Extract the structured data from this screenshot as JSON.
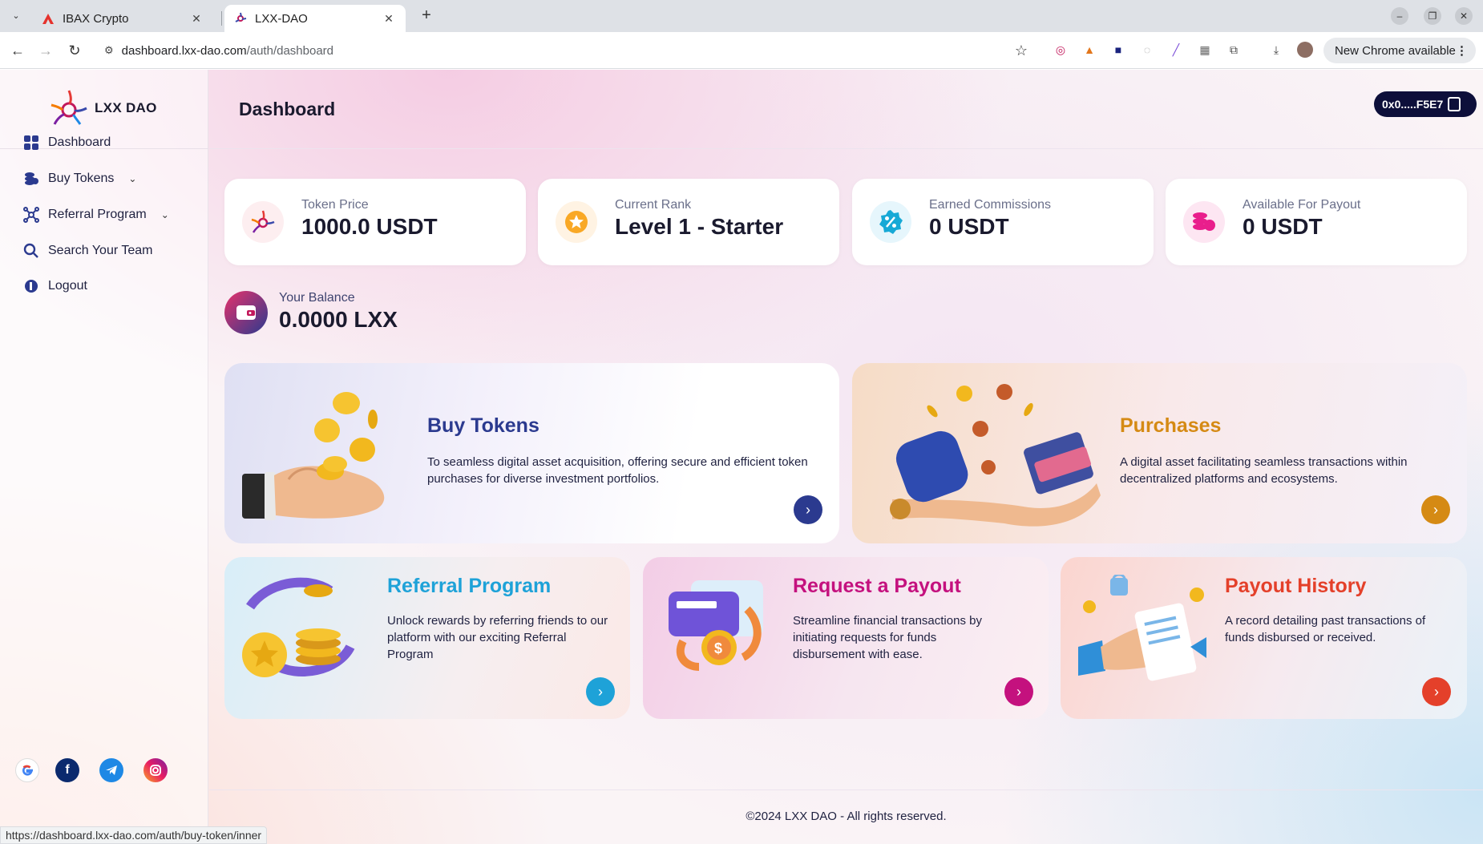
{
  "browser": {
    "tabs": [
      {
        "title": "IBAX Crypto",
        "active": false
      },
      {
        "title": "LXX-DAO",
        "active": true
      }
    ],
    "url_host": "dashboard.lxx-dao.com",
    "url_path": "/auth/dashboard",
    "update_button": "New Chrome available",
    "status_url": "https://dashboard.lxx-dao.com/auth/buy-token/inner"
  },
  "brand": {
    "name": "LXX DAO"
  },
  "sidebar": {
    "items": [
      {
        "label": "Dashboard",
        "icon": "grid-icon"
      },
      {
        "label": "Buy Tokens",
        "icon": "coins-icon",
        "has_submenu": true
      },
      {
        "label": "Referral Program",
        "icon": "network-icon",
        "has_submenu": true
      },
      {
        "label": "Search Your Team",
        "icon": "search-icon"
      },
      {
        "label": "Logout",
        "icon": "logout-icon"
      }
    ],
    "social": [
      "google-icon",
      "facebook-icon",
      "telegram-icon",
      "instagram-icon"
    ]
  },
  "header": {
    "title": "Dashboard",
    "wallet": "0x0.....F5E7"
  },
  "stats": [
    {
      "label": "Token Price",
      "value": "1000.0 USDT"
    },
    {
      "label": "Current Rank",
      "value": "Level 1 - Starter"
    },
    {
      "label": "Earned Commissions",
      "value": "0 USDT"
    },
    {
      "label": "Available For Payout",
      "value": "0 USDT"
    }
  ],
  "balance": {
    "label": "Your Balance",
    "value": "0.0000 LXX"
  },
  "features": [
    {
      "title": "Buy Tokens",
      "desc": "To seamless digital asset acquisition, offering secure and efficient token purchases for diverse investment portfolios.",
      "color": "#2b3a8f"
    },
    {
      "title": "Purchases",
      "desc": "A digital asset facilitating seamless transactions within decentralized platforms and ecosystems.",
      "color": "#d58a14"
    },
    {
      "title": "Referral Program",
      "desc": "Unlock rewards by referring friends to our platform with our exciting Referral Program",
      "color": "#1ea2d8"
    },
    {
      "title": "Request a Payout",
      "desc": "Streamline financial transactions by initiating requests for funds disbursement with ease.",
      "color": "#c4117e"
    },
    {
      "title": "Payout History",
      "desc": "A record detailing past transactions of funds disbursed or received.",
      "color": "#e4402a"
    }
  ],
  "footer": {
    "text": "©2024 LXX DAO - All rights reserved."
  }
}
